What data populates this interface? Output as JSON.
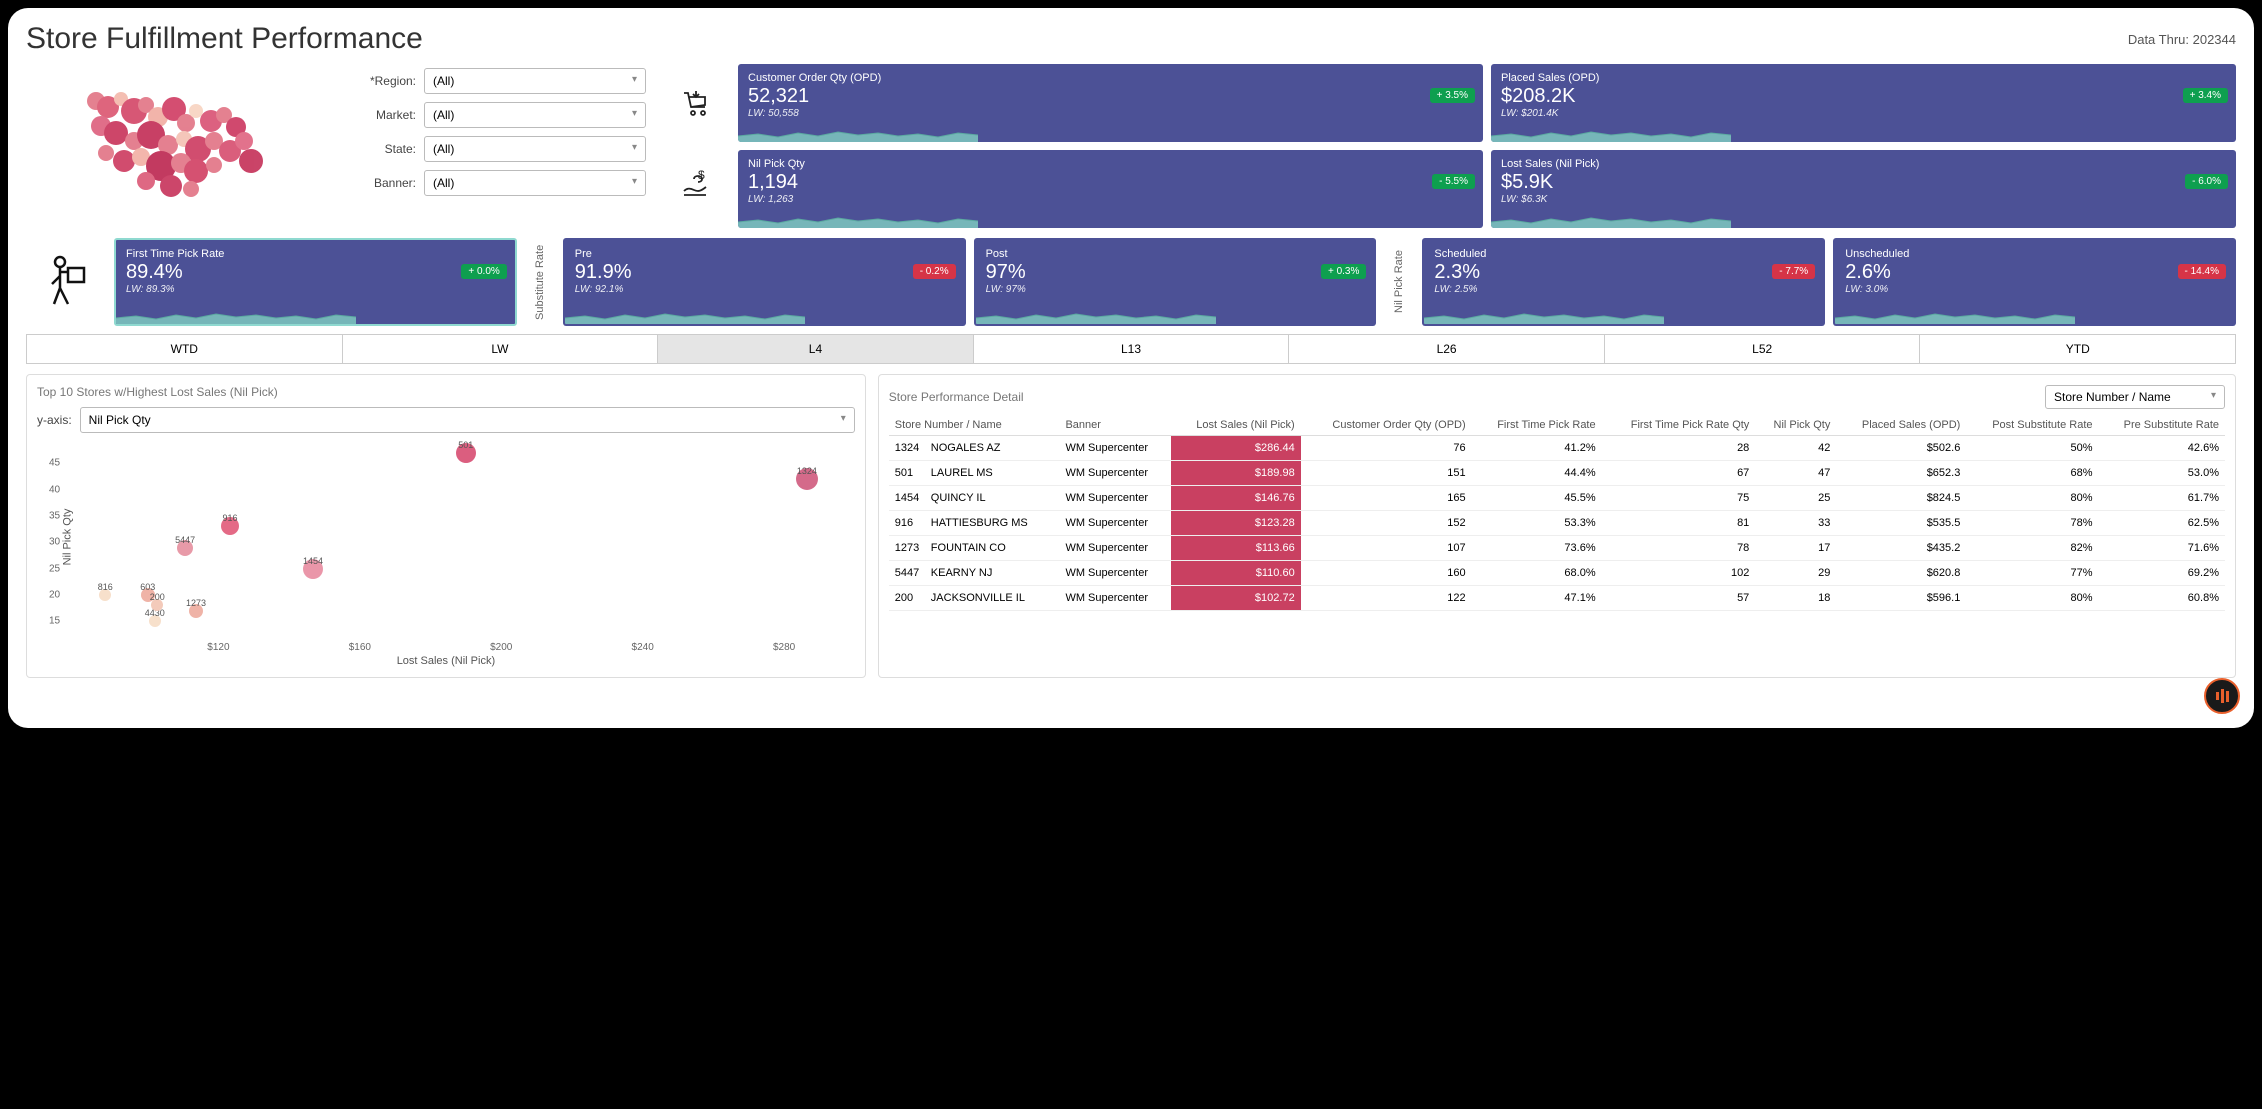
{
  "header": {
    "title": "Store Fulfillment Performance",
    "data_thru": "Data Thru: 202344"
  },
  "filters": {
    "region": {
      "label": "*Region:",
      "value": "(All)"
    },
    "market": {
      "label": "Market:",
      "value": "(All)"
    },
    "state": {
      "label": "State:",
      "value": "(All)"
    },
    "banner": {
      "label": "Banner:",
      "value": "(All)"
    }
  },
  "kpi": [
    {
      "label": "Customer Order Qty (OPD)",
      "value": "52,321",
      "lw": "LW: 50,558",
      "delta": "+ 3.5%",
      "pos": true
    },
    {
      "label": "Placed Sales (OPD)",
      "value": "$208.2K",
      "lw": "LW: $201.4K",
      "delta": "+ 3.4%",
      "pos": true
    },
    {
      "label": "Nil Pick Qty",
      "value": "1,194",
      "lw": "LW: 1,263",
      "delta": "- 5.5%",
      "pos": true
    },
    {
      "label": "Lost Sales (Nil Pick)",
      "value": "$5.9K",
      "lw": "LW: $6.3K",
      "delta": "- 6.0%",
      "pos": true
    }
  ],
  "row2": {
    "ftpr": {
      "label": "First Time Pick Rate",
      "value": "89.4%",
      "lw": "LW: 89.3%",
      "delta": "+ 0.0%",
      "pos": true
    },
    "sub_label": "Substitute Rate",
    "pre": {
      "label": "Pre",
      "value": "91.9%",
      "lw": "LW: 92.1%",
      "delta": "- 0.2%",
      "pos": false
    },
    "post": {
      "label": "Post",
      "value": "97%",
      "lw": "LW: 97%",
      "delta": "+ 0.3%",
      "pos": true
    },
    "nil_label": "Nil Pick Rate",
    "sched": {
      "label": "Scheduled",
      "value": "2.3%",
      "lw": "LW: 2.5%",
      "delta": "- 7.7%",
      "pos": false
    },
    "unsched": {
      "label": "Unscheduled",
      "value": "2.6%",
      "lw": "LW: 3.0%",
      "delta": "- 14.4%",
      "pos": false
    }
  },
  "tabs": [
    "WTD",
    "LW",
    "L4",
    "L13",
    "L26",
    "L52",
    "YTD"
  ],
  "tab_active": "L4",
  "scatter": {
    "title": "Top 10 Stores w/Highest Lost Sales (Nil Pick)",
    "yaxis_label": "y-axis:",
    "yaxis_value": "Nil Pick Qty",
    "xlabel": "Lost Sales (Nil Pick)",
    "ylabel": "Nil Pick Qty"
  },
  "chart_data": {
    "type": "scatter",
    "xlabel": "Lost Sales (Nil Pick)",
    "ylabel": "Nil Pick Qty",
    "xlim": [
      80,
      300
    ],
    "ylim": [
      12,
      50
    ],
    "xticks": [
      120,
      160,
      200,
      240,
      280
    ],
    "yticks": [
      15,
      20,
      25,
      30,
      35,
      40,
      45
    ],
    "points": [
      {
        "label": "1324",
        "x": 286.44,
        "y": 42,
        "size": 22,
        "color": "#d46a8a"
      },
      {
        "label": "501",
        "x": 189.98,
        "y": 47,
        "size": 20,
        "color": "#db5e7f"
      },
      {
        "label": "916",
        "x": 123.28,
        "y": 33,
        "size": 18,
        "color": "#e46a86"
      },
      {
        "label": "5447",
        "x": 110.6,
        "y": 29,
        "size": 16,
        "color": "#e89aa8"
      },
      {
        "label": "1454",
        "x": 146.76,
        "y": 25,
        "size": 20,
        "color": "#ea96a9"
      },
      {
        "label": "1273",
        "x": 113.66,
        "y": 17,
        "size": 14,
        "color": "#efb3a7"
      },
      {
        "label": "603",
        "x": 100.0,
        "y": 20,
        "size": 14,
        "color": "#efb3a7"
      },
      {
        "label": "816",
        "x": 88.0,
        "y": 20,
        "size": 12,
        "color": "#f7e0cb"
      },
      {
        "label": "4430",
        "x": 102.0,
        "y": 15,
        "size": 12,
        "color": "#f7e0cb"
      },
      {
        "label": "200",
        "x": 102.72,
        "y": 18,
        "size": 12,
        "color": "#f3caba"
      }
    ]
  },
  "detail": {
    "title": "Store Performance Detail",
    "select": "Store Number / Name",
    "columns": [
      "Store Number / Name",
      "Banner",
      "Lost Sales (Nil Pick)",
      "Customer Order Qty (OPD)",
      "First Time Pick Rate",
      "First Time Pick Rate Qty",
      "Nil Pick Qty",
      "Placed Sales (OPD)",
      "Post Substitute Rate",
      "Pre Substitute Rate"
    ],
    "rows": [
      {
        "num": "1324",
        "name": "NOGALES AZ",
        "banner": "WM Supercenter",
        "lost": "$286.44",
        "coq": "76",
        "ftpr": "41.2%",
        "ftprq": "28",
        "npq": "42",
        "ps": "$502.6",
        "post": "50%",
        "pre": "42.6%"
      },
      {
        "num": "501",
        "name": "LAUREL MS",
        "banner": "WM Supercenter",
        "lost": "$189.98",
        "coq": "151",
        "ftpr": "44.4%",
        "ftprq": "67",
        "npq": "47",
        "ps": "$652.3",
        "post": "68%",
        "pre": "53.0%"
      },
      {
        "num": "1454",
        "name": "QUINCY IL",
        "banner": "WM Supercenter",
        "lost": "$146.76",
        "coq": "165",
        "ftpr": "45.5%",
        "ftprq": "75",
        "npq": "25",
        "ps": "$824.5",
        "post": "80%",
        "pre": "61.7%"
      },
      {
        "num": "916",
        "name": "HATTIESBURG MS",
        "banner": "WM Supercenter",
        "lost": "$123.28",
        "coq": "152",
        "ftpr": "53.3%",
        "ftprq": "81",
        "npq": "33",
        "ps": "$535.5",
        "post": "78%",
        "pre": "62.5%"
      },
      {
        "num": "1273",
        "name": "FOUNTAIN CO",
        "banner": "WM Supercenter",
        "lost": "$113.66",
        "coq": "107",
        "ftpr": "73.6%",
        "ftprq": "78",
        "npq": "17",
        "ps": "$435.2",
        "post": "82%",
        "pre": "71.6%"
      },
      {
        "num": "5447",
        "name": "KEARNY NJ",
        "banner": "WM Supercenter",
        "lost": "$110.60",
        "coq": "160",
        "ftpr": "68.0%",
        "ftprq": "102",
        "npq": "29",
        "ps": "$620.8",
        "post": "77%",
        "pre": "69.2%"
      },
      {
        "num": "200",
        "name": "JACKSONVILLE IL",
        "banner": "WM Supercenter",
        "lost": "$102.72",
        "coq": "122",
        "ftpr": "47.1%",
        "ftprq": "57",
        "npq": "18",
        "ps": "$596.1",
        "post": "80%",
        "pre": "60.8%"
      }
    ]
  }
}
